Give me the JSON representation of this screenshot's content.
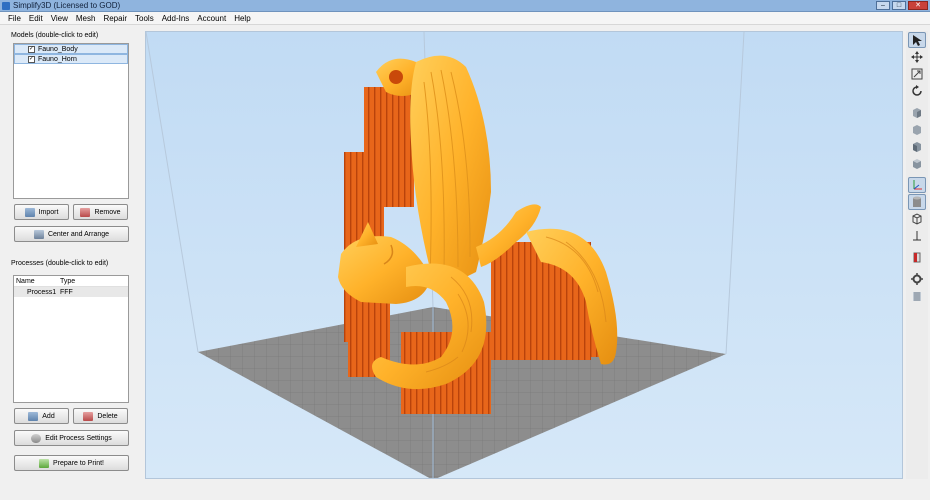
{
  "window": {
    "title": "Simplify3D (Licensed to GOD)"
  },
  "menu": [
    "File",
    "Edit",
    "View",
    "Mesh",
    "Repair",
    "Tools",
    "Add-Ins",
    "Account",
    "Help"
  ],
  "models": {
    "label": "Models (double-click to edit)",
    "items": [
      {
        "name": "Fauno_Body"
      },
      {
        "name": "Fauno_Horn"
      }
    ],
    "import_label": "Import",
    "remove_label": "Remove",
    "center_label": "Center and Arrange"
  },
  "processes": {
    "label": "Processes (double-click to edit)",
    "col_name": "Name",
    "col_type": "Type",
    "rows": [
      {
        "name": "Process1",
        "type": "FFF"
      }
    ],
    "add_label": "Add",
    "delete_label": "Delete",
    "edit_label": "Edit Process Settings",
    "prepare_label": "Prepare to Print!"
  },
  "toolbar_icons": [
    "select-icon",
    "move-icon",
    "scale-icon",
    "rotate-icon",
    "view-iso-icon",
    "view-front-icon",
    "view-side-icon",
    "view-top-icon",
    "axes-icon",
    "solid-view-icon",
    "wireframe-icon",
    "cross-section-icon",
    "support-icon",
    "settings-gear-icon",
    "layer-view-icon"
  ],
  "colors": {
    "viewport_bg": "#c9e0f6",
    "build_plate": "#8a8a8a",
    "model_orange": "#ffb22a",
    "support_orange": "#e5600e"
  }
}
